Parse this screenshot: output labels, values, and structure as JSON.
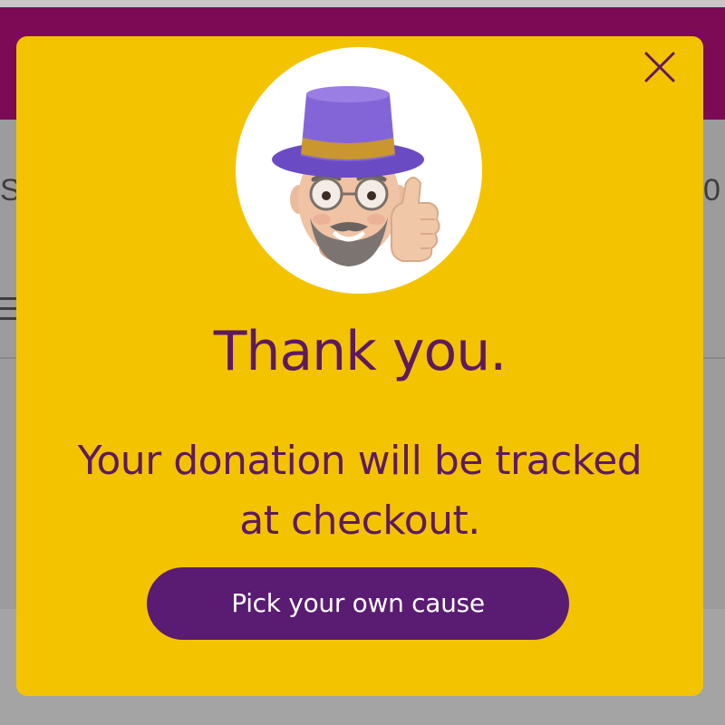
{
  "background": {
    "left_fragment": "S",
    "right_fragment": "0"
  },
  "modal": {
    "title": "Thank you.",
    "message": "Your donation will be tracked at checkout.",
    "cta_label": "Pick your own cause",
    "close_icon": "close-icon",
    "avatar_icon": "memoji-top-hat-thumbs-up"
  },
  "colors": {
    "modal_background": "#f4c300",
    "text": "#5e1a5e",
    "button_background": "#5a1b72",
    "button_text": "#ffffff",
    "header": "#7d0a55",
    "overlay": "#9c9c9c"
  }
}
